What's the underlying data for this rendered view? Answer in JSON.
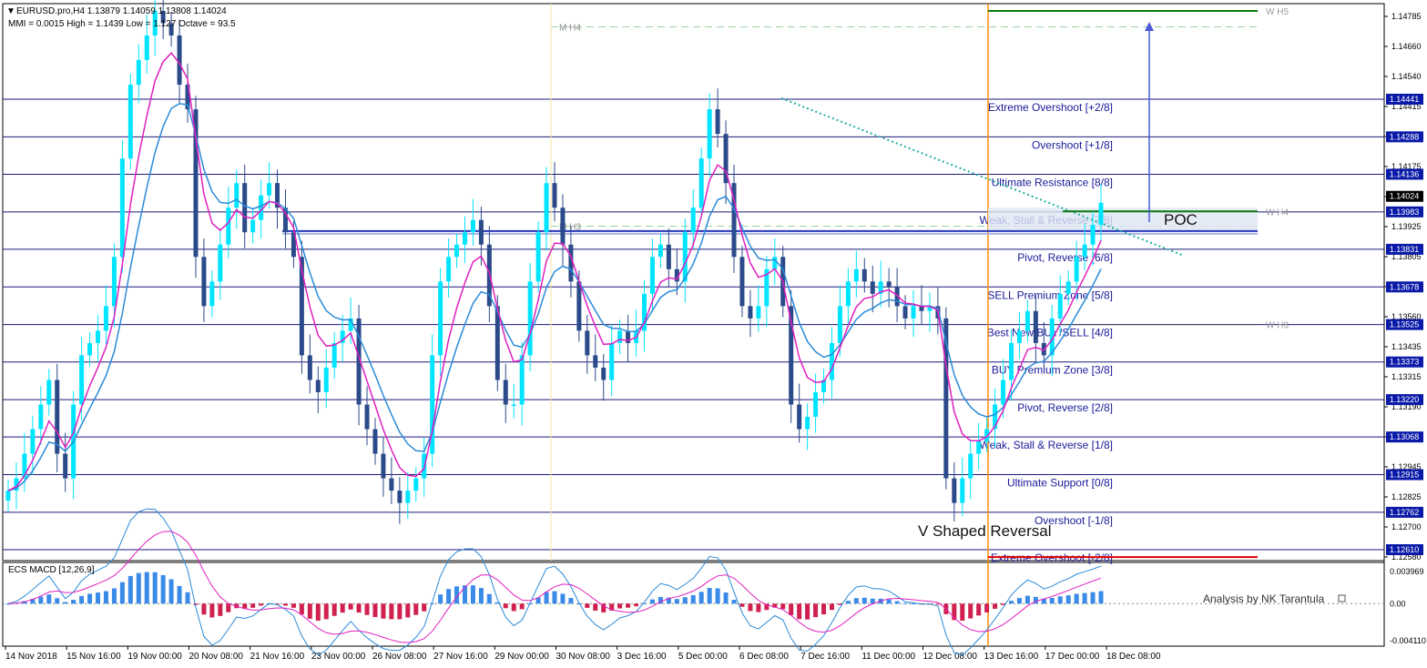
{
  "header": {
    "symbol_line": "EURUSD.pro,H4  1.13879 1.14059 1.13808 1.14024",
    "indicator_line": "MMI = 0.0015   High = 1.1439   Low = 1.127   Octave = 93.5"
  },
  "macd_title": "ECS MACD [12,26,9]",
  "credit": "Analysis by NK Tarantula",
  "annotations": {
    "poc": "POC",
    "v_shape": "V Shaped Reversal"
  },
  "colors": {
    "bull_candle": "#00e5ff",
    "bear_candle": "#2b4a8a",
    "fast_ma": "#e020c0",
    "slow_ma": "#2a8ad8",
    "murrey_line": "#1a1a7a",
    "tag_bg": "#0a1aa8",
    "current_tag_bg": "#000000",
    "green_line": "#0a7a0a",
    "red_line": "#e00000",
    "vertical_marker": "#ff8c00",
    "arrow": "#4a5ad8",
    "trendline": "#20b0a0",
    "macd_pos": "#3a8ae8",
    "macd_neg": "#d02050"
  },
  "chart_data": {
    "type": "candlestick",
    "price_axis_ticks": [
      "1.14785",
      "1.14660",
      "1.14540",
      "1.14415",
      "1.14295",
      "1.14175",
      "1.14050",
      "1.13925",
      "1.13805",
      "1.13680",
      "1.13560",
      "1.13435",
      "1.13315",
      "1.13190",
      "1.13070",
      "1.12945",
      "1.12825",
      "1.12700",
      "1.12580"
    ],
    "price_tags": [
      {
        "label": "1.14441",
        "value": 1.14441
      },
      {
        "label": "1.14288",
        "value": 1.14288
      },
      {
        "label": "1.14136",
        "value": 1.14136
      },
      {
        "label": "1.14024",
        "value": 1.14024,
        "current": true
      },
      {
        "label": "1.13983",
        "value": 1.13983
      },
      {
        "label": "1.13831",
        "value": 1.13831
      },
      {
        "label": "1.13678",
        "value": 1.13678
      },
      {
        "label": "1.13525",
        "value": 1.13525
      },
      {
        "label": "1.13373",
        "value": 1.13373
      },
      {
        "label": "1.13220",
        "value": 1.1322
      },
      {
        "label": "1.13068",
        "value": 1.13068
      },
      {
        "label": "1.12915",
        "value": 1.12915
      },
      {
        "label": "1.12762",
        "value": 1.12762
      },
      {
        "label": "1.12610",
        "value": 1.1261
      }
    ],
    "time_axis_ticks": [
      "14 Nov 2018",
      "15 Nov 16:00",
      "19 Nov 00:00",
      "20 Nov 08:00",
      "21 Nov 16:00",
      "23 Nov 00:00",
      "26 Nov 08:00",
      "27 Nov 16:00",
      "29 Nov 00:00",
      "30 Nov 08:00",
      "3 Dec 16:00",
      "5 Dec 00:00",
      "6 Dec 08:00",
      "7 Dec 16:00",
      "11 Dec 00:00",
      "12 Dec 08:00",
      "13 Dec 16:00",
      "17 Dec 00:00",
      "18 Dec 08:00"
    ],
    "murrey_levels": [
      {
        "label": "Extreme Overshoot [+2/8]",
        "value": 1.14441
      },
      {
        "label": "Overshoot [+1/8]",
        "value": 1.14288
      },
      {
        "label": "Ultimate Resistance [8/8]",
        "value": 1.14136
      },
      {
        "label": "Weak, Stall & Reverse [7/8]",
        "value": 1.13983
      },
      {
        "label": "Pivot, Reverse [6/8]",
        "value": 1.13831
      },
      {
        "label": "SELL Premium Zone [5/8]",
        "value": 1.13678
      },
      {
        "label": "Best New BUY/SELL [4/8]",
        "value": 1.13525
      },
      {
        "label": "BUY Premium Zone [3/8]",
        "value": 1.13373
      },
      {
        "label": "Pivot, Reverse [2/8]",
        "value": 1.1322
      },
      {
        "label": "Weak, Stall & Reverse [1/8]",
        "value": 1.13068
      },
      {
        "label": "Ultimate Support [0/8]",
        "value": 1.12915
      },
      {
        "label": "Overshoot [-1/8]",
        "value": 1.12762
      },
      {
        "label": "Extreme Overshoot [-2/8]",
        "value": 1.1261
      }
    ],
    "weekly_levels": [
      {
        "label": "W H5",
        "value": 1.148
      },
      {
        "label": "W H4",
        "value": 1.13985
      },
      {
        "label": "W H3",
        "value": 1.13525
      }
    ],
    "monthly_levels": [
      {
        "label": "M H4",
        "value": 1.14735
      },
      {
        "label": "M H3",
        "value": 1.13925
      }
    ],
    "poc_level": 1.13905,
    "macd_axis_ticks": [
      "0.003969",
      "0.00",
      "-0.004110"
    ],
    "macd_range": [
      -0.00411,
      0.003969
    ],
    "closes": [
      1.1285,
      1.129,
      1.13,
      1.131,
      1.132,
      1.133,
      1.13,
      1.129,
      1.132,
      1.134,
      1.1345,
      1.135,
      1.136,
      1.138,
      1.142,
      1.145,
      1.146,
      1.147,
      1.148,
      1.1475,
      1.147,
      1.145,
      1.144,
      1.138,
      1.136,
      1.137,
      1.1385,
      1.14,
      1.141,
      1.139,
      1.1395,
      1.1405,
      1.141,
      1.14,
      1.139,
      1.138,
      1.134,
      1.133,
      1.1325,
      1.1335,
      1.1345,
      1.135,
      1.1355,
      1.132,
      1.131,
      1.13,
      1.129,
      1.1285,
      1.128,
      1.1285,
      1.129,
      1.13,
      1.134,
      1.137,
      1.138,
      1.1385,
      1.139,
      1.1395,
      1.1385,
      1.136,
      1.133,
      1.132,
      1.132,
      1.134,
      1.137,
      1.139,
      1.141,
      1.14,
      1.1385,
      1.137,
      1.135,
      1.134,
      1.1335,
      1.133,
      1.1345,
      1.135,
      1.1345,
      1.135,
      1.1365,
      1.138,
      1.1385,
      1.1375,
      1.137,
      1.139,
      1.14,
      1.142,
      1.144,
      1.143,
      1.141,
      1.138,
      1.136,
      1.1355,
      1.136,
      1.1375,
      1.138,
      1.136,
      1.132,
      1.131,
      1.1315,
      1.1325,
      1.133,
      1.1345,
      1.136,
      1.137,
      1.1375,
      1.137,
      1.1365,
      1.137,
      1.1368,
      1.136,
      1.1355,
      1.136,
      1.1358,
      1.136,
      1.1355,
      1.129,
      1.128,
      1.129,
      1.13,
      1.1305,
      1.131,
      1.132,
      1.133,
      1.1345,
      1.135,
      1.1358,
      1.1345,
      1.134,
      1.1355,
      1.1365,
      1.137,
      1.138,
      1.1385,
      1.1393,
      1.1402
    ]
  }
}
